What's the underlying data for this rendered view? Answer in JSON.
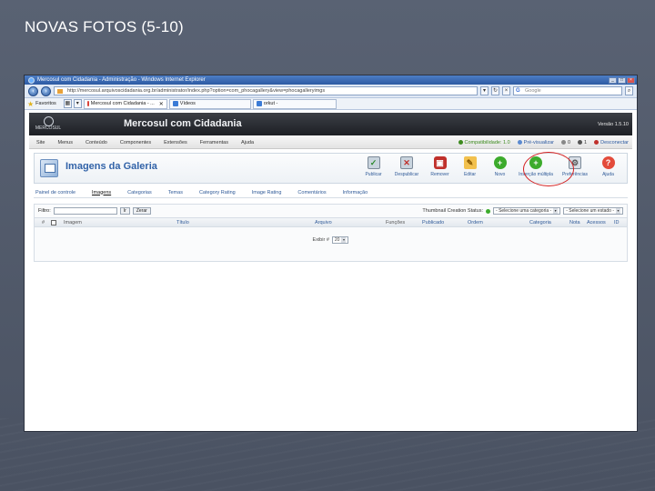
{
  "slide": {
    "title": "NOVAS FOTOS (5-10)"
  },
  "browser": {
    "window_title": "Mercosul com Cidadania - Administração - Windows Internet Explorer",
    "url": "http://mercosul.arquivoscidadania.org.br/administrator/index.php?option=com_phocagallery&view=phocagalleryimgs",
    "search_placeholder": "Google",
    "favorites_label": "Favoritos",
    "tabs": [
      {
        "label": "Mercosul com Cidadania - ..."
      },
      {
        "label": "Vídeos"
      },
      {
        "label": "orkut -"
      }
    ]
  },
  "joomla": {
    "site_name": "Mercosul com Cidadania",
    "version": "Versão 1.5.10",
    "logo_text": "MERCOSUL",
    "menu": [
      "Site",
      "Menus",
      "Conteúdo",
      "Componentes",
      "Extensões",
      "Ferramentas",
      "Ajuda"
    ],
    "status": {
      "compat": "Compatibilidade: 1.0",
      "preview": "Pré-visualizar",
      "messages": "0",
      "users": "1",
      "logout": "Desconectar"
    },
    "page_title": "Imagens da Galeria",
    "toolbar": [
      {
        "label": "Publicar",
        "icon": "publish-icon"
      },
      {
        "label": "Despublicar",
        "icon": "unpublish-icon"
      },
      {
        "label": "Remover",
        "icon": "delete-icon"
      },
      {
        "label": "Editar",
        "icon": "edit-icon"
      },
      {
        "label": "Novo",
        "icon": "new-icon"
      },
      {
        "label": "Inserção múltipla",
        "icon": "multiple-add-icon"
      },
      {
        "label": "Preferências",
        "icon": "preferences-icon"
      },
      {
        "label": "Ajuda",
        "icon": "help-icon"
      }
    ],
    "submenu": [
      "Painel de controle",
      "Imagens",
      "Categorias",
      "Temas",
      "Category Rating",
      "Image Rating",
      "Comentários",
      "Informação"
    ],
    "filter": {
      "label": "Filtro:",
      "go": "Ir",
      "reset": "Zerar",
      "thumb_status": "Thumbnail Creation Status:",
      "category_select": "- Selecione uma categoria -",
      "state_select": "- Selecione um estado -"
    },
    "table_headers": [
      "#",
      "Imagem",
      "Título",
      "Arquivo",
      "Funções",
      "Publicado",
      "Ordem",
      "Categoria",
      "Nota",
      "Acessos",
      "ID"
    ],
    "footer": {
      "display_label": "Exibir #",
      "display_value": "20"
    }
  }
}
